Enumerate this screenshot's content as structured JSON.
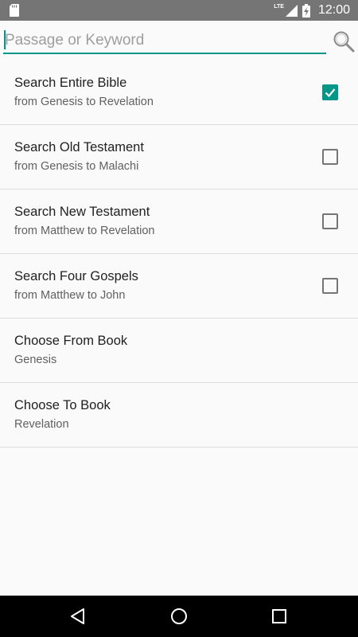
{
  "status_bar": {
    "network_label": "LTE",
    "time": "12:00"
  },
  "search": {
    "placeholder": "Passage or Keyword",
    "value": ""
  },
  "options": [
    {
      "title": "Search Entire Bible",
      "subtitle": "from Genesis to Revelation",
      "checked": true
    },
    {
      "title": "Search Old Testament",
      "subtitle": "from Genesis to Malachi",
      "checked": false
    },
    {
      "title": "Search New Testament",
      "subtitle": "from Matthew to Revelation",
      "checked": false
    },
    {
      "title": "Search Four Gospels",
      "subtitle": "from Matthew to John",
      "checked": false
    },
    {
      "title": "Choose From Book",
      "subtitle": "Genesis"
    },
    {
      "title": "Choose To Book",
      "subtitle": "Revelation"
    }
  ],
  "colors": {
    "accent": "#009688",
    "status_bar": "#757575",
    "nav_bar": "#000000",
    "background": "#fafafa"
  },
  "icons": {
    "search": "search-icon",
    "sd_card": "sd-card-icon",
    "signal": "signal-icon",
    "battery": "battery-charging-icon",
    "nav_back": "back-icon",
    "nav_home": "home-icon",
    "nav_recents": "recents-icon"
  }
}
